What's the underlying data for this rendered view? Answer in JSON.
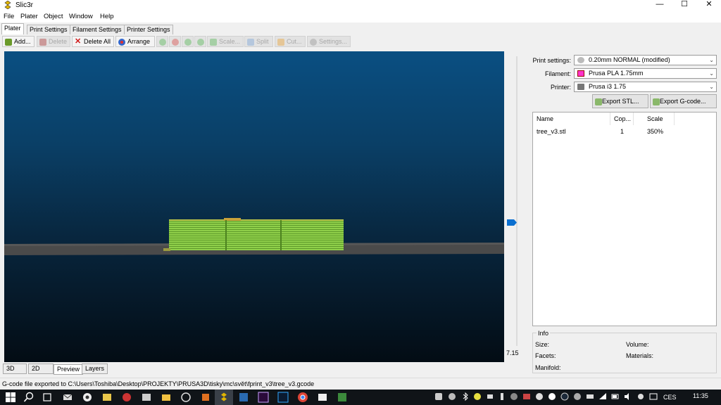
{
  "window": {
    "title": "Slic3r",
    "minimize": "—",
    "maximize": "☐",
    "close": "✕"
  },
  "menu": [
    "File",
    "Plater",
    "Object",
    "Window",
    "Help"
  ],
  "tabs": [
    "Plater",
    "Print Settings",
    "Filament Settings",
    "Printer Settings"
  ],
  "toolbar": {
    "add": "Add...",
    "delete": "Delete",
    "delete_all": "Delete All",
    "arrange": "Arrange",
    "scale": "Scale...",
    "split": "Split",
    "cut": "Cut...",
    "settings": "Settings..."
  },
  "viewport": {
    "layer_value": "7.15"
  },
  "view_tabs": [
    "3D",
    "2D",
    "Preview",
    "Layers"
  ],
  "presets": {
    "print_label": "Print settings:",
    "print_value": "0.20mm NORMAL (modified)",
    "filament_label": "Filament:",
    "filament_value": "Prusa PLA 1.75mm",
    "filament_color": "#ff33cc",
    "printer_label": "Printer:",
    "printer_value": "Prusa i3 1.75"
  },
  "export": {
    "stl": "Export STL...",
    "gcode": "Export G-code..."
  },
  "object_list": {
    "headers": [
      "Name",
      "Cop...",
      "Scale"
    ],
    "rows": [
      {
        "name": "tree_v3.stl",
        "copies": "1",
        "scale": "350%"
      }
    ]
  },
  "info": {
    "title": "Info",
    "size": "Size:",
    "volume": "Volume:",
    "facets": "Facets:",
    "materials": "Materials:",
    "manifold": "Manifold:"
  },
  "status": "G-code file exported to C:\\Users\\Toshiba\\Desktop\\PROJEKTY\\PRUSA3D\\tisky\\mc\\svět\\fprint_v3\\tree_v3.gcode",
  "taskbar": {
    "lang": "CES",
    "time": "11:35"
  },
  "colors": {
    "accent_blue": "#0a6fd0",
    "model_green": "#8fd14f",
    "bed": "#4a4a4a"
  }
}
